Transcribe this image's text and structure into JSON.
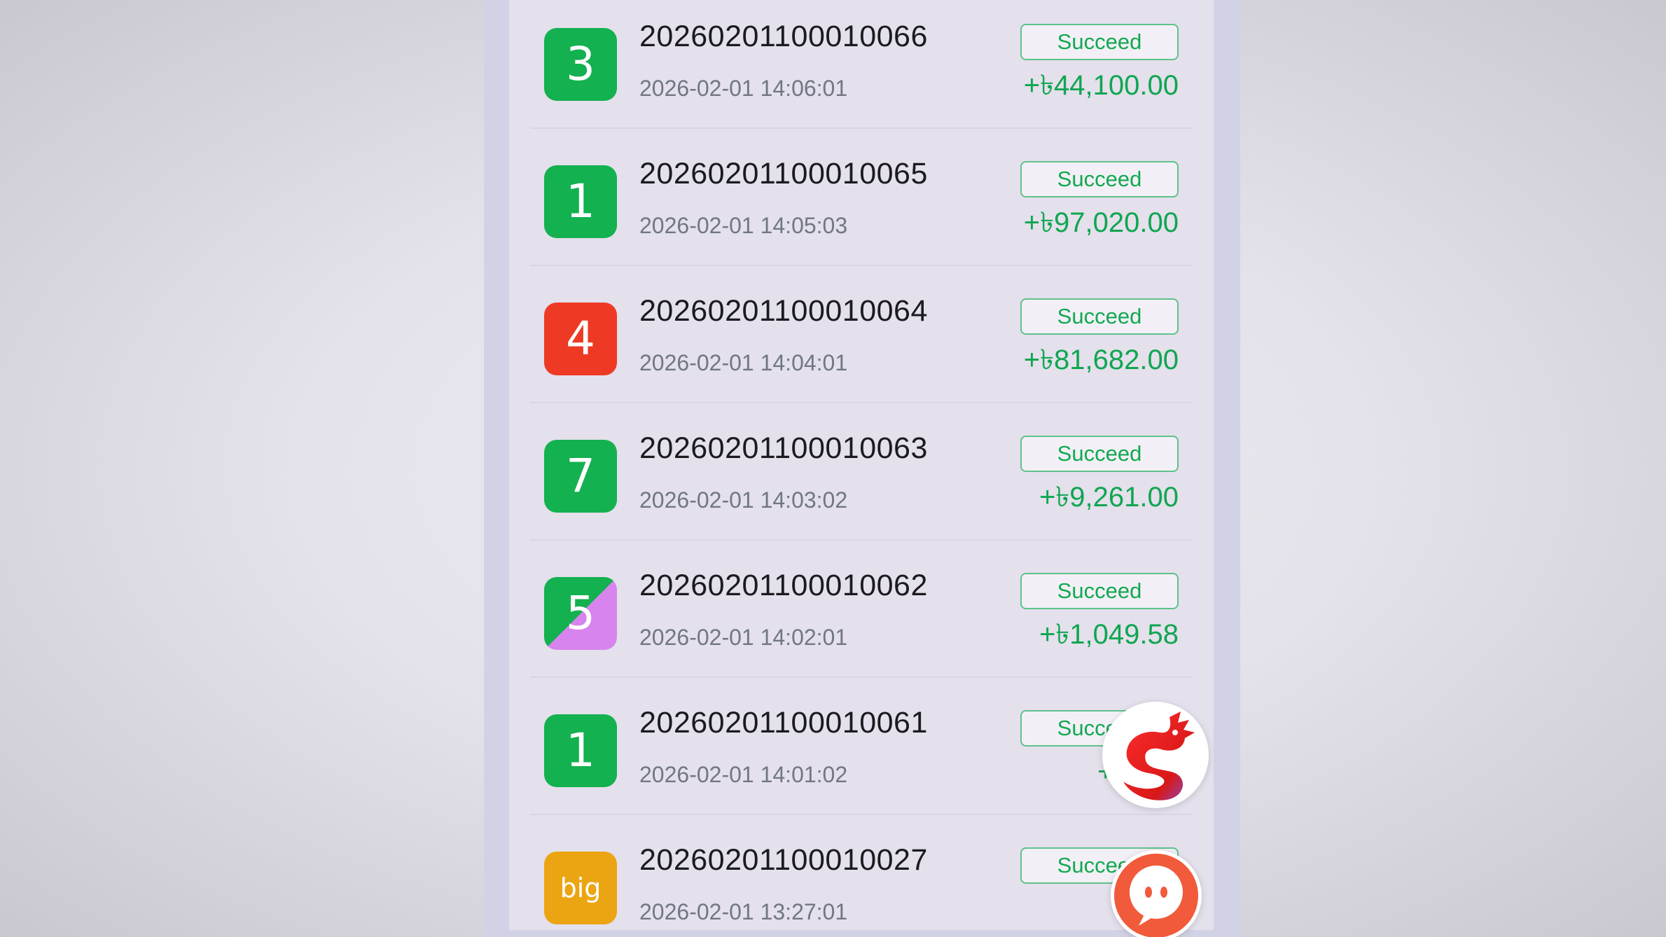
{
  "records": [
    {
      "ball": "3",
      "ball_color": "#13b14f",
      "order_id": "20260201100010066",
      "time": "2026-02-01 14:06:01",
      "status": "Succeed",
      "amount": "+৳44,100.00"
    },
    {
      "ball": "1",
      "ball_color": "#13b14f",
      "order_id": "20260201100010065",
      "time": "2026-02-01 14:05:03",
      "status": "Succeed",
      "amount": "+৳97,020.00"
    },
    {
      "ball": "4",
      "ball_color": "#ee3a24",
      "order_id": "20260201100010064",
      "time": "2026-02-01 14:04:01",
      "status": "Succeed",
      "amount": "+৳81,682.00"
    },
    {
      "ball": "7",
      "ball_color": "#13b14f",
      "order_id": "20260201100010063",
      "time": "2026-02-01 14:03:02",
      "status": "Succeed",
      "amount": "+৳9,261.00"
    },
    {
      "ball": "5",
      "ball_color": "#13b14f",
      "ball_color_2": "#d884ee",
      "order_id": "20260201100010062",
      "time": "2026-02-01 14:02:01",
      "status": "Succeed",
      "amount": "+৳1,049.58"
    },
    {
      "ball": "1",
      "ball_color": "#13b14f",
      "order_id": "20260201100010061",
      "time": "2026-02-01 14:01:02",
      "status": "Succeed",
      "amount": "+৳"
    },
    {
      "ball": "big",
      "ball_color": "#eca512",
      "order_id": "20260201100010027",
      "time": "2026-02-01 13:27:01",
      "status": "Succeed",
      "amount": "+"
    }
  ],
  "floating": {
    "dragon_icon": "dragon-logo-icon",
    "chat_icon": "chat-bubble-icon"
  }
}
